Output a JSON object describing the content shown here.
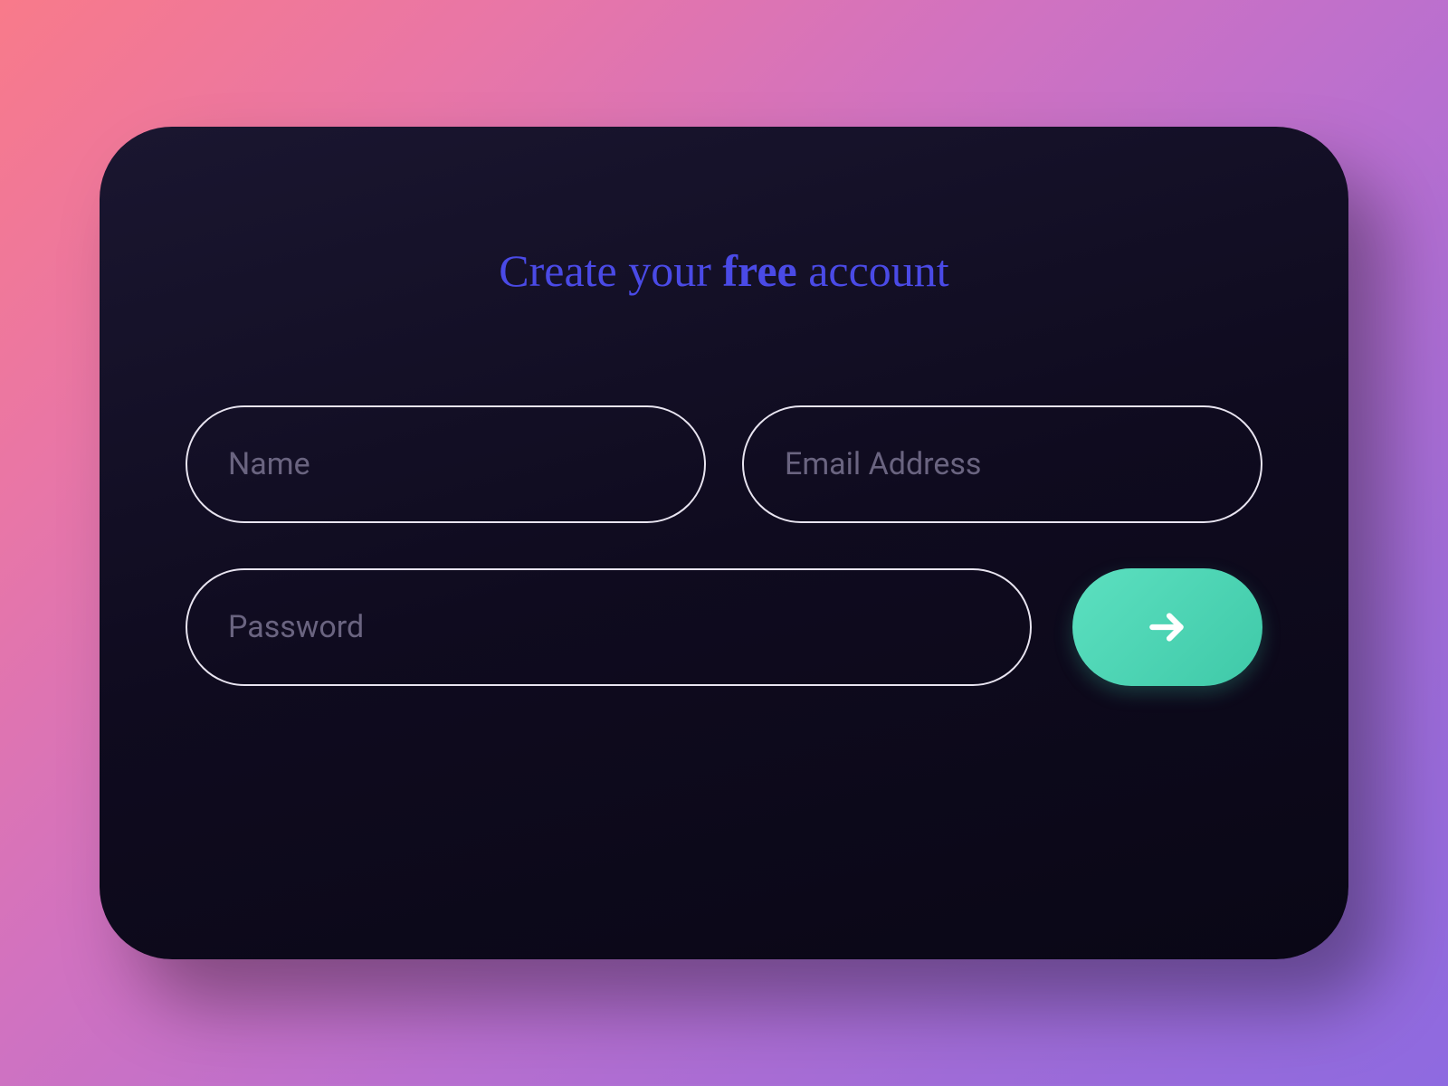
{
  "title": {
    "prefix": "Create your ",
    "emphasis": "free",
    "suffix": " account"
  },
  "form": {
    "name_placeholder": "Name",
    "email_placeholder": "Email Address",
    "password_placeholder": "Password"
  },
  "icons": {
    "submit": "arrow-right-icon"
  },
  "colors": {
    "accent": "#4a4ae6",
    "submit": "#3fc9a8",
    "card_bg": "#12102a"
  }
}
